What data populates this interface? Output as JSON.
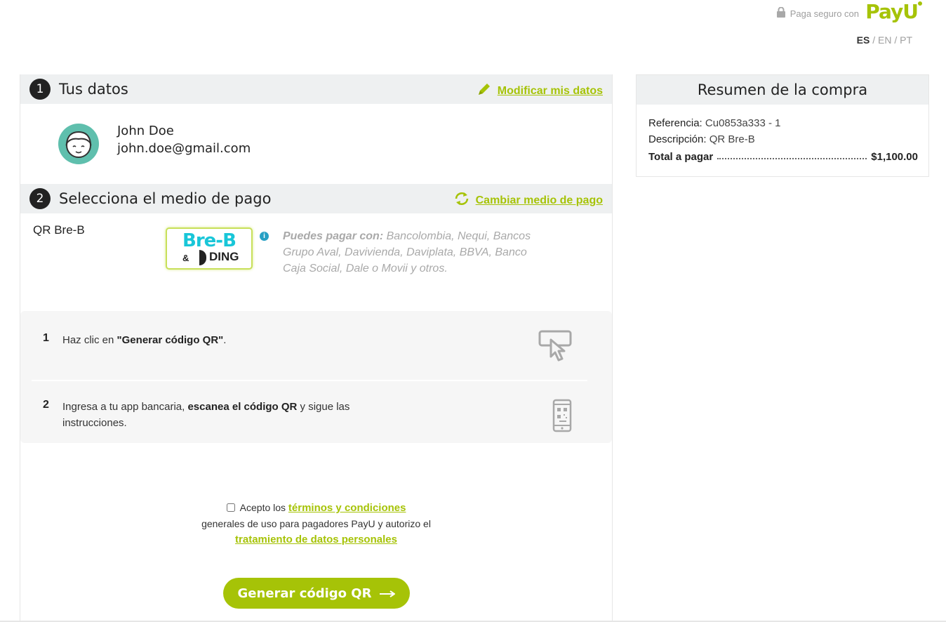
{
  "header": {
    "secure_text": "Paga seguro con",
    "brand": "PayU",
    "languages": [
      "ES",
      "EN",
      "PT"
    ],
    "active_language": "ES"
  },
  "section1": {
    "number": "1",
    "title": "Tus datos",
    "edit_link": "Modificar mis datos",
    "user_name": "John Doe",
    "user_email": "john.doe@gmail.com"
  },
  "section2": {
    "number": "2",
    "title": "Selecciona el medio de pago",
    "change_link": "Cambiar medio de pago",
    "method_name": "QR Bre-B",
    "brand_main": "Bre-B",
    "brand_amp": "&",
    "brand_sub": "DING",
    "can_pay_label": "Puedes pagar con:",
    "can_pay_list": "Bancolombia, Nequi, Bancos Grupo Aval, Davivienda, Daviplata, BBVA, Banco Caja Social, Dale o Movii y otros."
  },
  "steps": [
    {
      "n": "1",
      "text_before": "Haz clic en ",
      "bold": "\"Generar código QR\"",
      "text_after": "."
    },
    {
      "n": "2",
      "text_before": "Ingresa a tu app bancaria, ",
      "bold": "escanea el código QR",
      "text_after": " y sigue las instrucciones."
    }
  ],
  "terms": {
    "accept": "Acepto los",
    "terms_link": "términos y condiciones",
    "middle": "generales de uso para pagadores PayU y autorizo el",
    "data_link": "tratamiento de datos personales",
    "checked": false
  },
  "generate_button": "Generar código QR",
  "summary": {
    "title": "Resumen de la compra",
    "ref_label": "Referencia:",
    "ref_value": "Cu0853a333 - 1",
    "desc_label": "Descripción:",
    "desc_value": "QR Bre-B",
    "total_label": "Total a pagar",
    "total_value": "$1,100.00"
  },
  "colors": {
    "accent": "#a6c307",
    "header_bg": "#eef0f1",
    "breb_blue": "#18c6d8",
    "info_blue": "#26a0c4"
  }
}
